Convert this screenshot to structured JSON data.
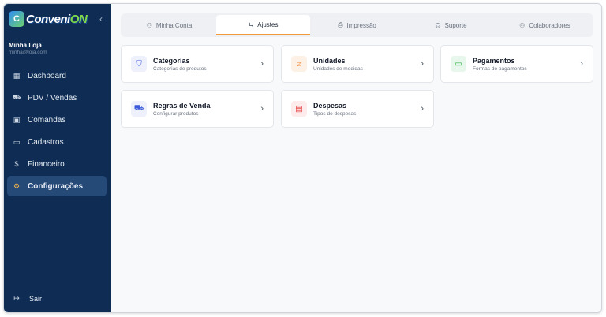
{
  "brand": {
    "logo_text": "Conveni",
    "logo_accent": "ON",
    "logo_badge": "C"
  },
  "store": {
    "name": "Minha Loja",
    "email": "minha@loja.com"
  },
  "sidebar": {
    "items": [
      {
        "icon": "▦",
        "label": "Dashboard"
      },
      {
        "icon": "⛟",
        "label": "PDV / Vendas"
      },
      {
        "icon": "▣",
        "label": "Comandas"
      },
      {
        "icon": "▭",
        "label": "Cadastros"
      },
      {
        "icon": "$",
        "label": "Financeiro"
      },
      {
        "icon": "⚙",
        "label": "Configurações"
      }
    ],
    "logout": {
      "icon": "↦",
      "label": "Sair"
    }
  },
  "tabs": [
    {
      "icon": "⚇",
      "label": "Minha Conta"
    },
    {
      "icon": "⇆",
      "label": "Ajustes"
    },
    {
      "icon": "⎙",
      "label": "Impressão"
    },
    {
      "icon": "☊",
      "label": "Suporte"
    },
    {
      "icon": "⚇",
      "label": "Colaboradores"
    }
  ],
  "cards": [
    {
      "icon": "⛉",
      "title": "Categorias",
      "subtitle": "Categorias de produtos",
      "color": "#3b5bdb",
      "bg": "#eef1fb"
    },
    {
      "icon": "⧄",
      "title": "Unidades",
      "subtitle": "Unidades de medidas",
      "color": "#f08c3c",
      "bg": "#fdf1e6"
    },
    {
      "icon": "▭",
      "title": "Pagamentos",
      "subtitle": "Formas de pagamentos",
      "color": "#2fb344",
      "bg": "#e8f7ec"
    },
    {
      "icon": "⛟",
      "title": "Regras de Venda",
      "subtitle": "Configurar produtos",
      "color": "#3b5bdb",
      "bg": "#eef1fb"
    },
    {
      "icon": "▤",
      "title": "Despesas",
      "subtitle": "Tipos de despesas",
      "color": "#e03131",
      "bg": "#fdeceb"
    }
  ],
  "chevron": "›"
}
